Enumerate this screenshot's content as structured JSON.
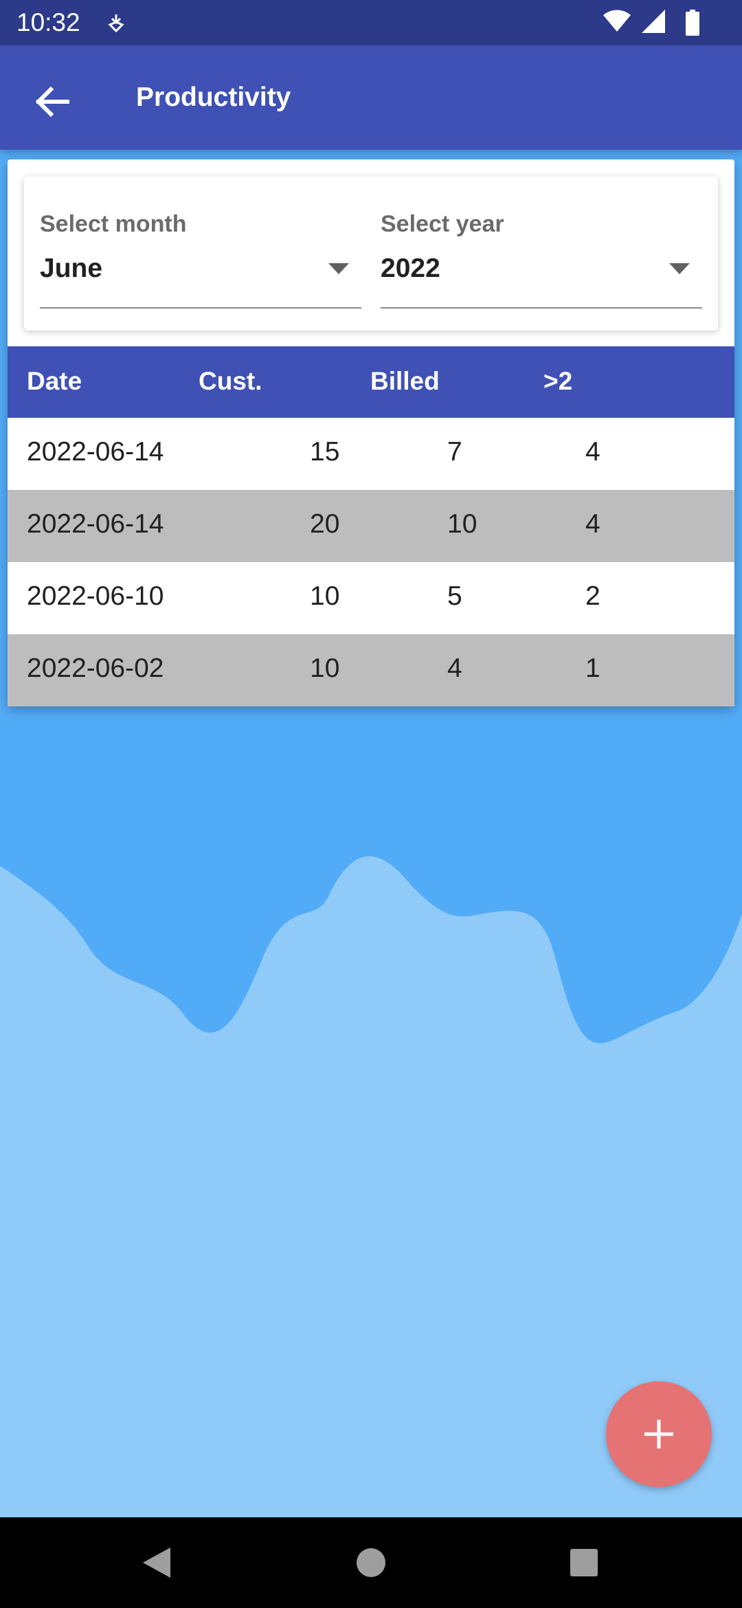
{
  "status_bar": {
    "time": "10:32",
    "notification_icon": "download-sync-icon",
    "icons": [
      "wifi-icon",
      "cellular-signal-icon",
      "battery-icon"
    ]
  },
  "app_bar": {
    "title": "Productivity",
    "back_icon": "arrow-back-icon"
  },
  "filters": {
    "month": {
      "label": "Select month",
      "value": "June"
    },
    "year": {
      "label": "Select year",
      "value": "2022"
    }
  },
  "table": {
    "columns": [
      "Date",
      "Cust.",
      "Billed",
      ">2"
    ],
    "rows": [
      [
        "2022-06-14",
        "15",
        "7",
        "4"
      ],
      [
        "2022-06-14",
        "20",
        "10",
        "4"
      ],
      [
        "2022-06-10",
        "10",
        "5",
        "2"
      ],
      [
        "2022-06-02",
        "10",
        "4",
        "1"
      ]
    ]
  },
  "fab": {
    "icon": "plus-icon"
  },
  "nav_bar": {
    "icons": [
      "back-triangle-icon",
      "home-circle-icon",
      "recents-square-icon"
    ]
  },
  "colors": {
    "status_bar": "#2d3a8a",
    "app_bar": "#3f51b5",
    "table_header": "#3f51b5",
    "row_alt": "#bdbdbd",
    "background_top": "#52abf6",
    "background_wave": "#90caf9",
    "fab": "#e57373"
  }
}
